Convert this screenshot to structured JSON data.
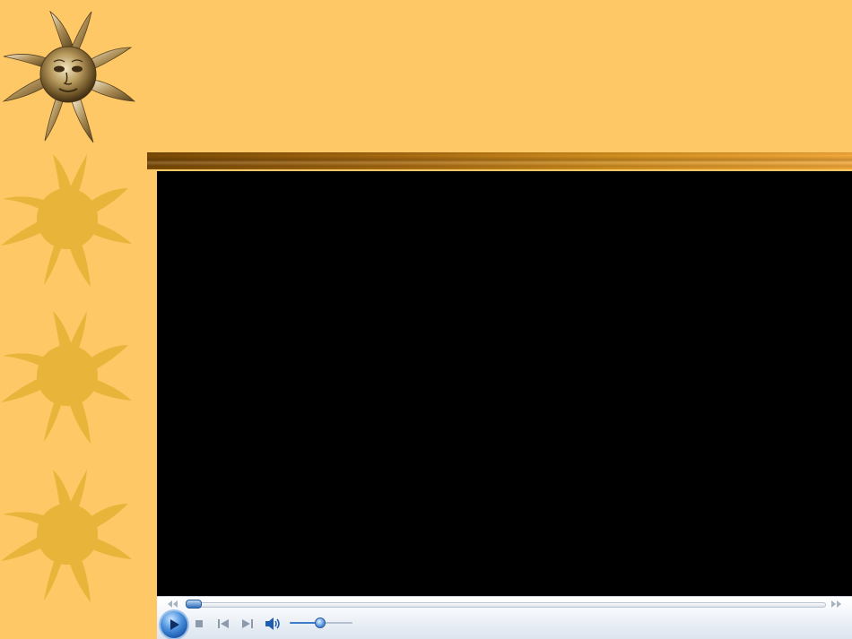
{
  "slide": {
    "background_color": "#FEC866",
    "sun_color": "#E8B43A",
    "bar_colors": [
      "#7A4A05",
      "#F4A93A"
    ]
  },
  "icons": {
    "sun_face": "sun-face-emblem-icon",
    "sun": "sun-icon",
    "play": "play-icon",
    "stop": "stop-icon",
    "previous": "skip-previous-icon",
    "next": "skip-next-icon",
    "volume": "speaker-icon",
    "seek_back": "rewind-icon",
    "seek_forward": "fast-forward-icon"
  },
  "player": {
    "state": "paused",
    "seek_position": 0.01,
    "volume_level": 0.5,
    "accent_color": "#2F6DB8"
  }
}
